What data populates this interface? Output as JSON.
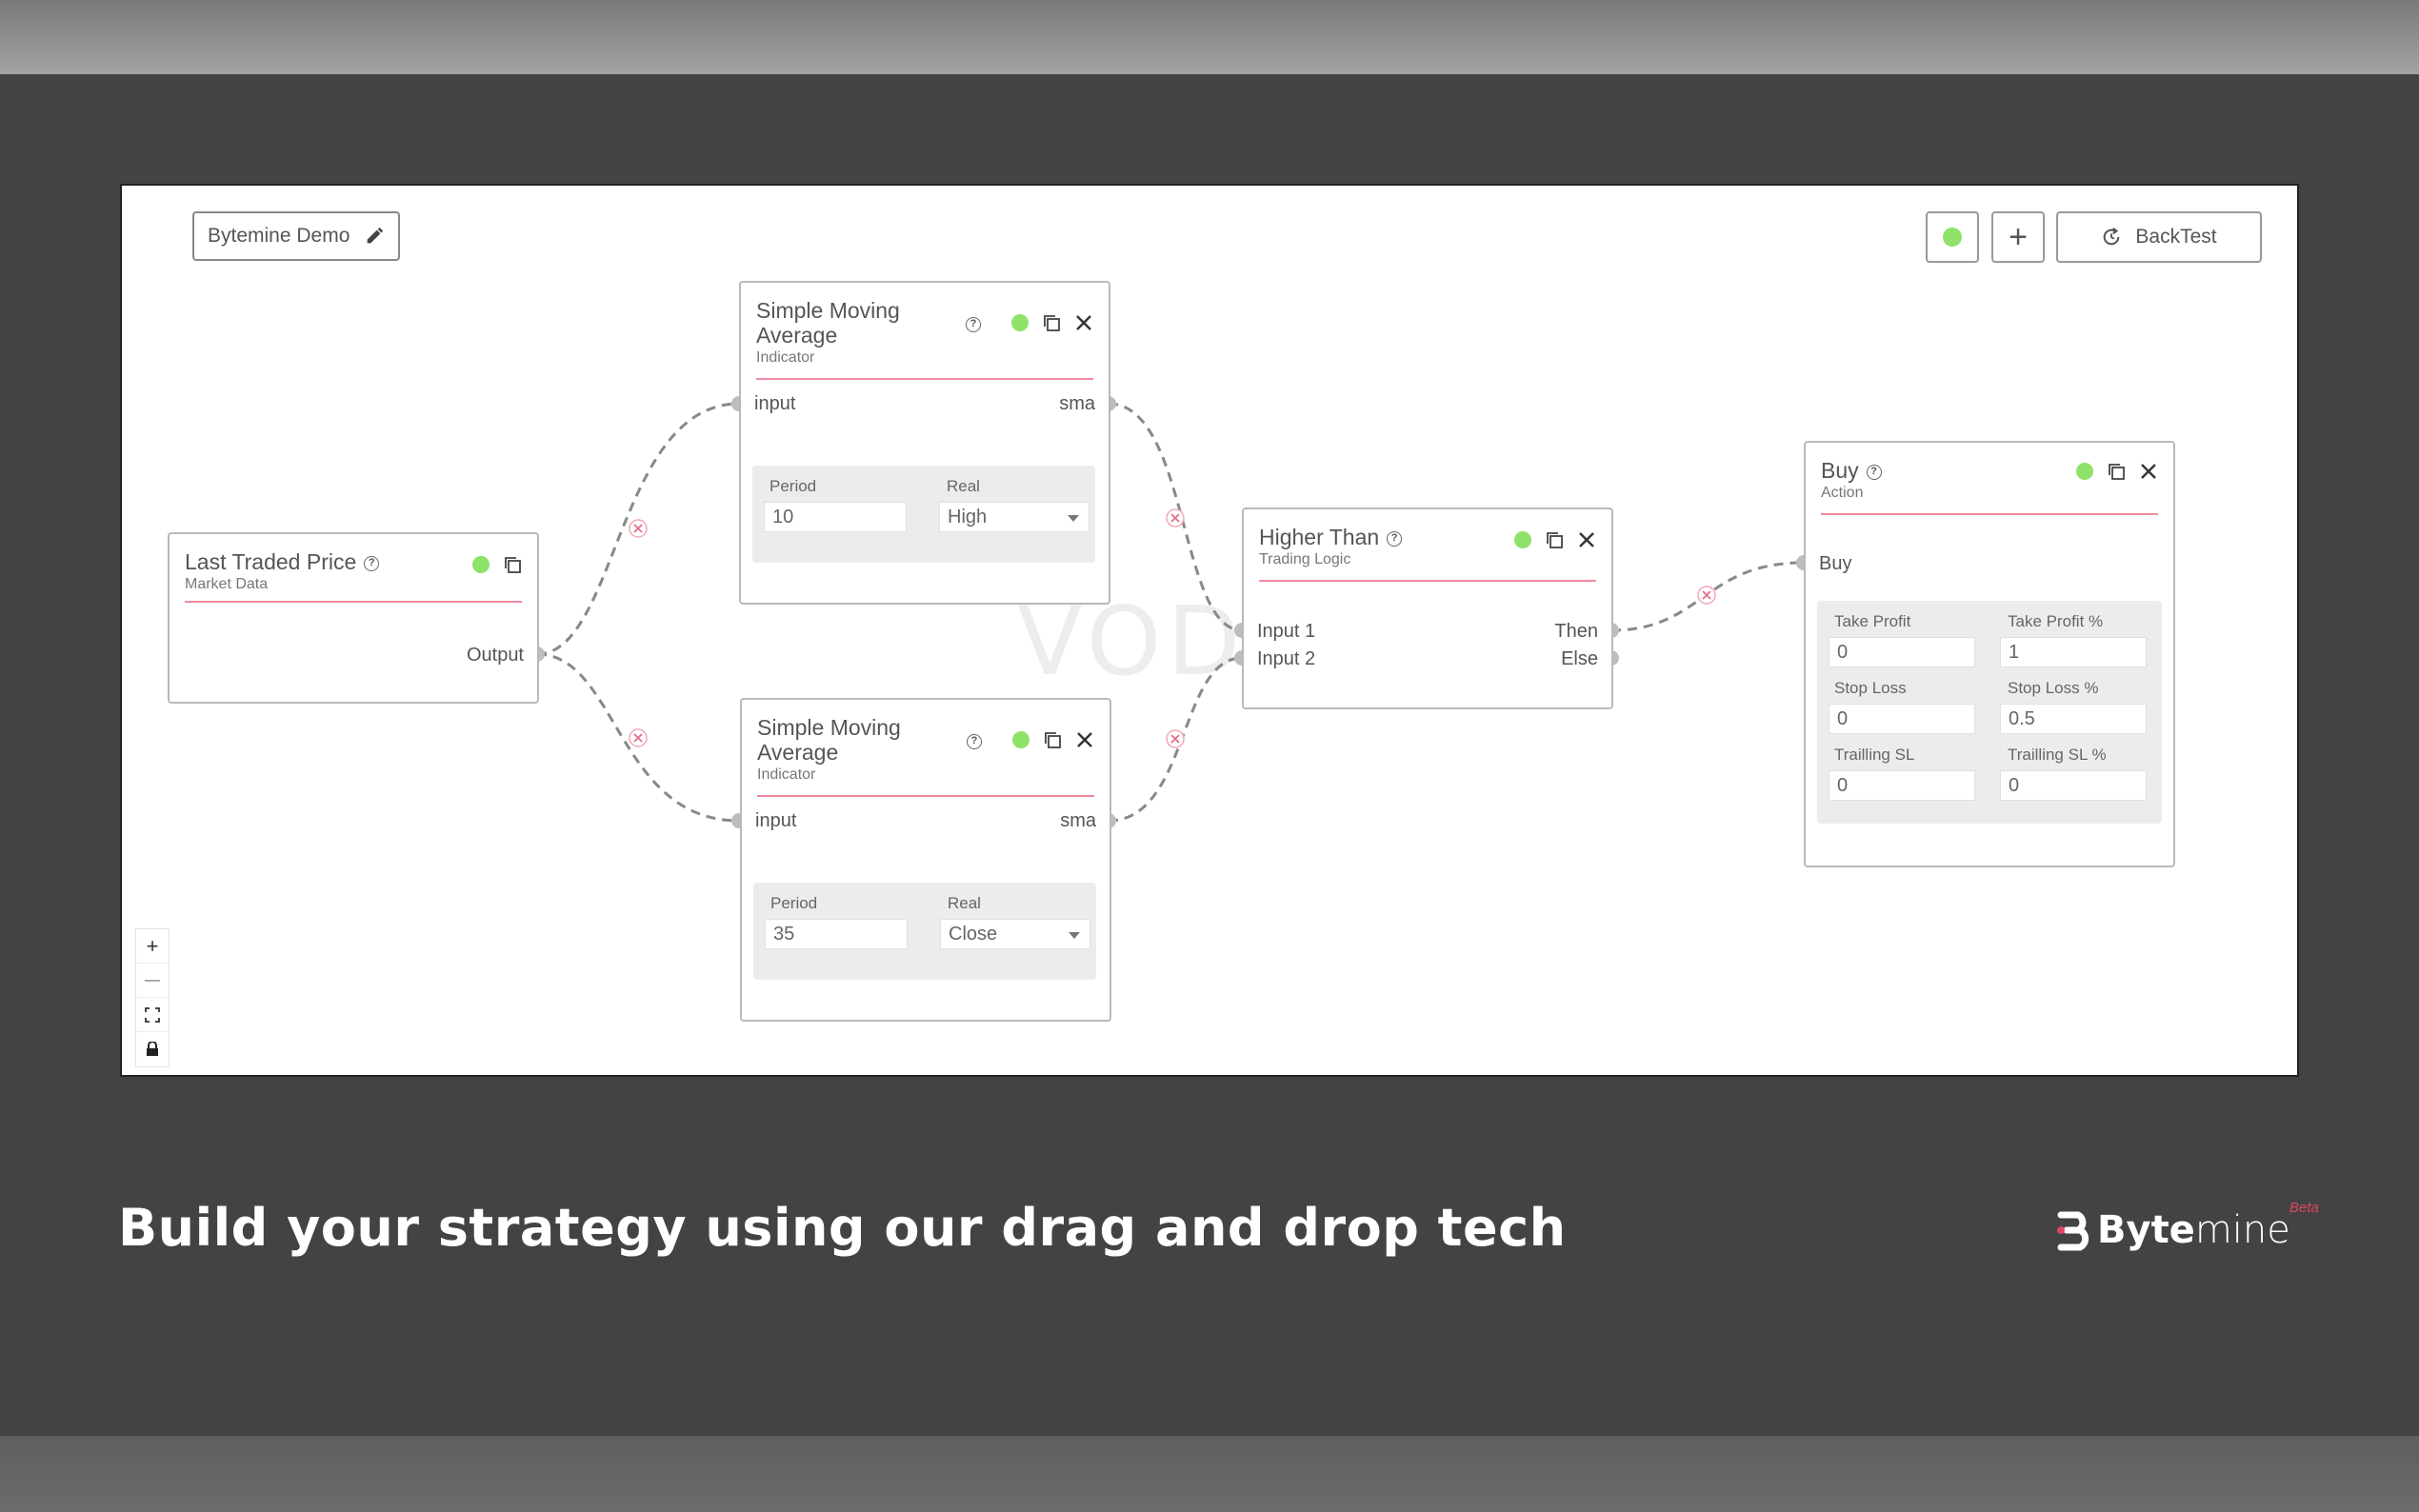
{
  "project": {
    "name": "Bytemine Demo"
  },
  "toolbar": {
    "add_label": "+",
    "backtest_label": "BackTest"
  },
  "watermark": "VOD",
  "nodes": {
    "ltp": {
      "title": "Last Traded Price",
      "subtitle": "Market Data",
      "output_label": "Output"
    },
    "sma1": {
      "title_line1": "Simple Moving",
      "title_line2": "Average",
      "subtitle": "Indicator",
      "input_label": "input",
      "output_label": "sma",
      "period_label": "Period",
      "period_value": "10",
      "real_label": "Real",
      "real_value": "High"
    },
    "sma2": {
      "title_line1": "Simple Moving",
      "title_line2": "Average",
      "subtitle": "Indicator",
      "input_label": "input",
      "output_label": "sma",
      "period_label": "Period",
      "period_value": "35",
      "real_label": "Real",
      "real_value": "Close"
    },
    "higher": {
      "title": "Higher Than",
      "subtitle": "Trading Logic",
      "input1_label": "Input 1",
      "input2_label": "Input 2",
      "then_label": "Then",
      "else_label": "Else"
    },
    "buy": {
      "title": "Buy",
      "subtitle": "Action",
      "input_label": "Buy",
      "take_profit_label": "Take Profit",
      "take_profit_value": "0",
      "take_profit_pct_label": "Take Profit %",
      "take_profit_pct_value": "1",
      "stop_loss_label": "Stop Loss",
      "stop_loss_value": "0",
      "stop_loss_pct_label": "Stop Loss %",
      "stop_loss_pct_value": "0.5",
      "trailing_sl_label": "Trailling SL",
      "trailing_sl_value": "0",
      "trailing_sl_pct_label": "Trailling SL %",
      "trailing_sl_pct_value": "0"
    }
  },
  "zoom": {
    "in": "+",
    "out": "—"
  },
  "footer": {
    "headline": "Build your strategy using our drag and drop tech"
  },
  "brand": {
    "name_bold": "Byte",
    "name_light": "mine",
    "badge": "Beta"
  },
  "colors": {
    "status_green": "#8ee26a",
    "accent_rule": "#f08aa0",
    "background": "#434343"
  }
}
